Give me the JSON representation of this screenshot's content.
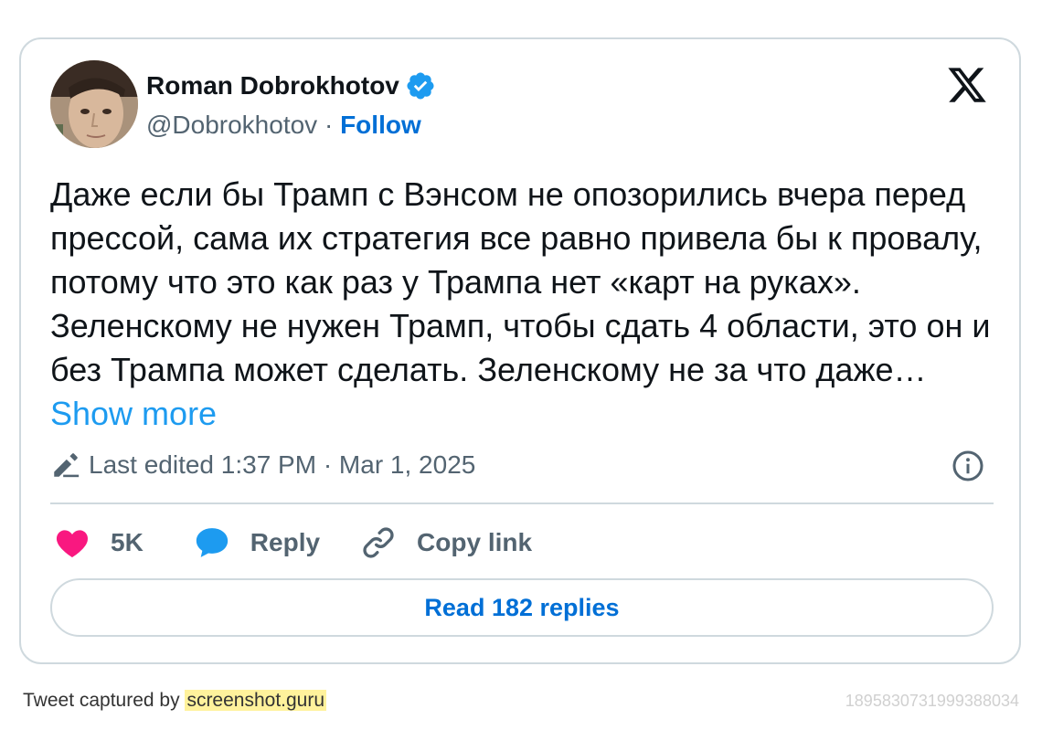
{
  "author": {
    "name": "Roman Dobrokhotov",
    "handle": "@Dobrokhotov",
    "separator": " · ",
    "follow_label": "Follow",
    "verified": true
  },
  "tweet": {
    "text": "Даже если бы Трамп с Вэнсом не опозорились вчера перед прессой, сама их стратегия все равно привела бы к провалу, потому что это как раз у Трампа нет «карт на руках». Зеленскому не нужен Трамп, чтобы сдать 4 области, это он и без Трампа может сделать. Зеленскому не за что даже… ",
    "show_more": "Show more",
    "edited": "Last edited 1:37 PM · Mar 1, 2025"
  },
  "actions": {
    "like_count": "5K",
    "reply_label": "Reply",
    "copy_label": "Copy link"
  },
  "read_replies": "Read 182 replies",
  "footer": {
    "captured_by": "Tweet captured by ",
    "site": "screenshot.guru",
    "tweet_id": "1895830731999388034"
  },
  "icons": {
    "verified": "verified-badge-icon",
    "platform": "x-logo-icon",
    "edit": "pencil-icon",
    "info": "info-icon",
    "like": "heart-icon",
    "reply": "speech-bubble-icon",
    "copy": "link-icon"
  },
  "colors": {
    "accent": "#1d9bf0",
    "follow": "#006fd6",
    "like": "#f91880",
    "muted": "#536471",
    "text": "#0f1419",
    "border": "#cfd9de"
  }
}
